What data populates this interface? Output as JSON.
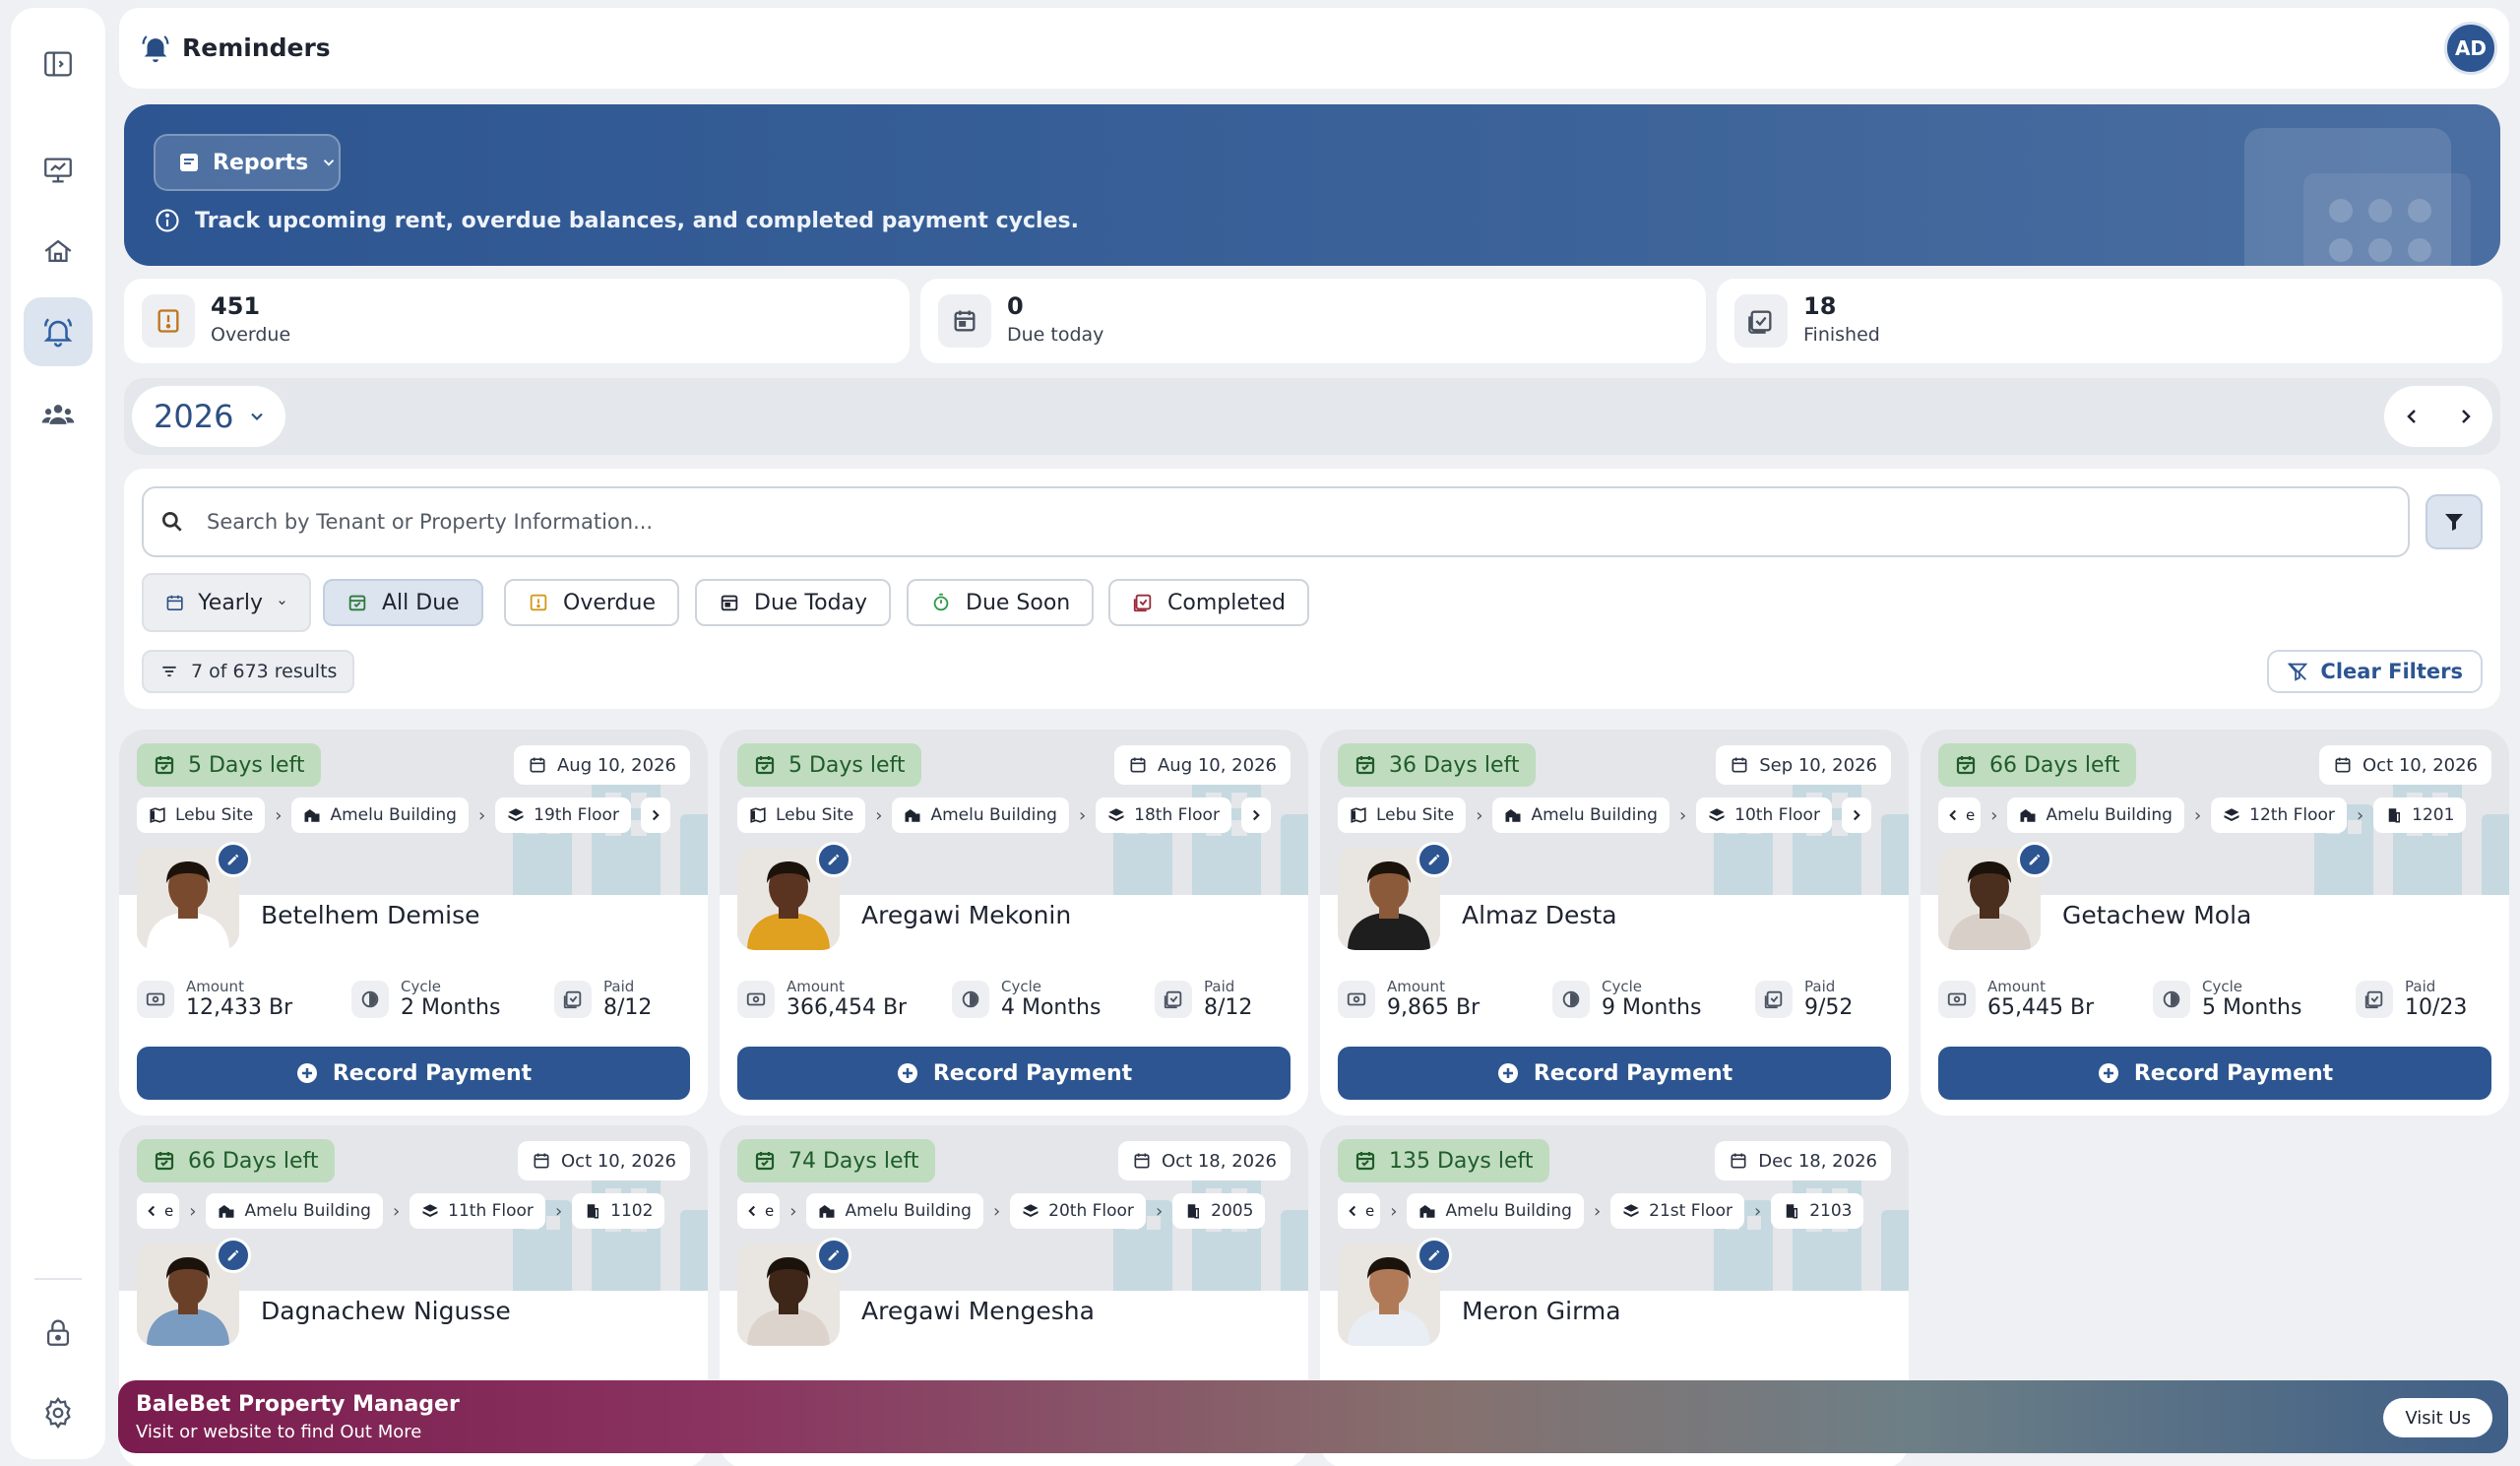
{
  "header": {
    "title": "Reminders",
    "user_initials": "AD"
  },
  "banner": {
    "reports_label": "Reports",
    "info_text": "Track upcoming rent, overdue balances, and completed payment cycles."
  },
  "stats": [
    {
      "value": "451",
      "label": "Overdue",
      "color": "#c0741f"
    },
    {
      "value": "0",
      "label": "Due today",
      "color": "#4a5260"
    },
    {
      "value": "18",
      "label": "Finished",
      "color": "#4a5260"
    }
  ],
  "year_selector": {
    "year": "2026"
  },
  "search": {
    "placeholder": "Search by Tenant or Property Information..."
  },
  "filters": {
    "period": "Yearly",
    "chips": [
      "All Due",
      "Overdue",
      "Due Today",
      "Due Soon",
      "Completed"
    ],
    "active": "All Due",
    "results_text": "7 of 673 results",
    "clear_label": "Clear Filters"
  },
  "labels": {
    "amount": "Amount",
    "cycle": "Cycle",
    "paid": "Paid",
    "record_payment": "Record Payment"
  },
  "cards": [
    {
      "days_left": "5 Days left",
      "date": "Aug 10, 2026",
      "crumbs": [
        "Lebu Site",
        "Amelu Building",
        "19th Floor"
      ],
      "name": "Betelhem Demise",
      "amount": "12,433 Br",
      "cycle": "2 Months",
      "paid": "8/12"
    },
    {
      "days_left": "5 Days left",
      "date": "Aug 10, 2026",
      "crumbs": [
        "Lebu Site",
        "Amelu Building",
        "18th Floor"
      ],
      "name": "Aregawi Mekonin",
      "amount": "366,454 Br",
      "cycle": "4 Months",
      "paid": "8/12"
    },
    {
      "days_left": "36 Days left",
      "date": "Sep 10, 2026",
      "crumbs": [
        "Lebu Site",
        "Amelu Building",
        "10th Floor"
      ],
      "name": "Almaz Desta",
      "amount": "9,865 Br",
      "cycle": "9 Months",
      "paid": "9/52"
    },
    {
      "days_left": "66 Days left",
      "date": "Oct 10, 2026",
      "crumbs": [
        "e",
        "Amelu Building",
        "12th Floor",
        "1201"
      ],
      "name": "Getachew Mola",
      "amount": "65,445 Br",
      "cycle": "5 Months",
      "paid": "10/23"
    },
    {
      "days_left": "66 Days left",
      "date": "Oct 10, 2026",
      "crumbs": [
        "e",
        "Amelu Building",
        "11th Floor",
        "1102"
      ],
      "name": "Dagnachew Nigusse"
    },
    {
      "days_left": "74 Days left",
      "date": "Oct 18, 2026",
      "crumbs": [
        "e",
        "Amelu Building",
        "20th Floor",
        "2005"
      ],
      "name": "Aregawi Mengesha"
    },
    {
      "days_left": "135 Days left",
      "date": "Dec 18, 2026",
      "crumbs": [
        "e",
        "Amelu Building",
        "21st Floor",
        "2103"
      ],
      "name": "Meron Girma"
    }
  ],
  "footer": {
    "title": "BaleBet Property Manager",
    "subtitle": "Visit or website to find Out More",
    "visit_label": "Visit Us"
  }
}
